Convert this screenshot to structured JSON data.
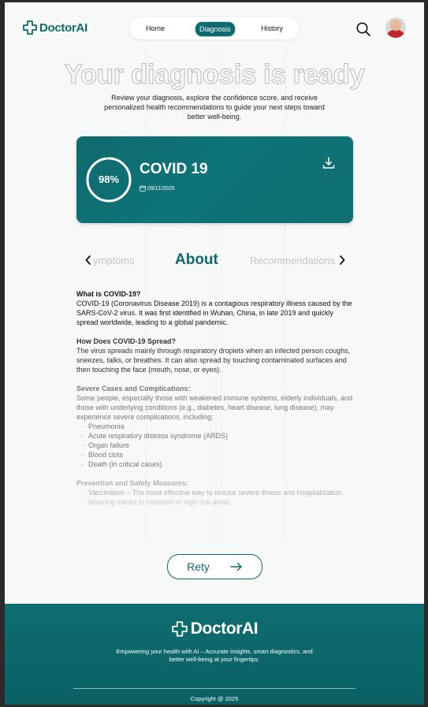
{
  "brand": {
    "name": "DoctorAI"
  },
  "nav": {
    "items": [
      {
        "label": "Home"
      },
      {
        "label": "Diagnosis"
      },
      {
        "label": "History"
      }
    ]
  },
  "hero": {
    "title": "Your diagnosis is ready",
    "subtitle": "Review your diagnosis, explore the confidence score, and receive personalized health recommendations to guide your next steps toward better well-being."
  },
  "result": {
    "confidence_label": "98%",
    "confidence": 0.98,
    "disease": "COVID 19",
    "date": "09/11/2025"
  },
  "tabs": {
    "prev": "ymptoms",
    "active": "About",
    "next": "Recommendations"
  },
  "about": {
    "sections": [
      {
        "heading": "What is COVID-19?",
        "body": "COVID-19 (Coronavirus Disease 2019) is a contagious respiratory illness caused by the SARS-CoV-2 virus. It was first identified in Wuhan, China, in late 2019 and quickly spread worldwide, leading to a global pandemic."
      },
      {
        "heading": "How Does COVID-19 Spread?",
        "body": "The virus spreads mainly through respiratory droplets when an infected person coughs, sneezes, talks, or breathes. It can also spread by touching contaminated surfaces and then touching the face (mouth, nose, or eyes)."
      },
      {
        "heading": "Severe Cases and Complications:",
        "body": "Some people, especially those with weakened immune systems, elderly individuals, and those with underlying conditions (e.g., diabetes, heart disease, lung disease), may experience severe complications, including:",
        "bullets": [
          "Pneumonia",
          "Acute respiratory distress syndrome (ARDS)",
          "Organ failure",
          "Blood clots",
          "Death (in critical cases)"
        ]
      },
      {
        "heading": "Prevention and Safety Measures:",
        "bullets": [
          "Vaccination – The most effective way to reduce severe illness and hospitalization.",
          "Wearing masks in crowded or high-risk areas."
        ]
      }
    ]
  },
  "retry": {
    "label": "Rety"
  },
  "footer": {
    "tagline": "Empowering your health with AI – Accurate insights, smart diagnostics, and better well-being at your fingertips.",
    "copyright": "Copyright @ 2025"
  },
  "colors": {
    "primary": "#0e6a6e",
    "background": "#f7f8f8"
  }
}
